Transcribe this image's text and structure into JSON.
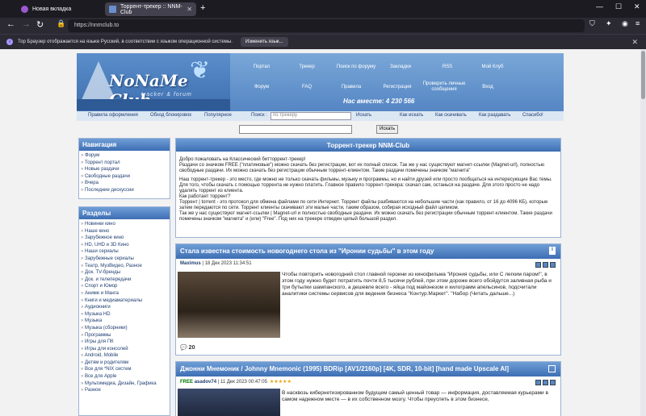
{
  "browser": {
    "tabs": [
      {
        "label": "Новая вкладка"
      },
      {
        "label": "Торрент-трекер :: NNM-Club"
      }
    ],
    "url": "https://nnmclub.to",
    "notification": {
      "text": "Тор Браузер отображается на языке Русский, в соответствии с языком операционной системы.",
      "button": "Изменить язык..."
    }
  },
  "header": {
    "logo_title": "NoNaMe Club",
    "logo_sub": "tracker & forum",
    "online": "Нас вместе: 4 230 566",
    "menu": [
      "Портал",
      "Трекер",
      "Поиск по форуму",
      "Закладки",
      "RSS",
      "Мой Клуб",
      "Форум",
      "FAQ",
      "Правила",
      "Регистрация",
      "Проверить личные сообщения",
      "Вход"
    ],
    "subnav": [
      "Правила оформления",
      "Обход блокировок",
      "Популярное",
      "Поиск :",
      "Искать",
      "Как искать",
      "Как скачивать",
      "Как раздавать",
      "Спасибо!"
    ],
    "search_placeholder": "по трекеру",
    "search_button": "Искать"
  },
  "nav": {
    "title": "Навигация",
    "items": [
      "Форум",
      "Торрент портал",
      "Новые раздачи",
      "Свободные раздачи",
      "Вчера",
      "Последние дискуссии"
    ]
  },
  "sections": {
    "title": "Разделы",
    "items": [
      "Новинки кино",
      "Наше кино",
      "Зарубежное кино",
      "HD, UHD и 3D Кино",
      "Наши сериалы",
      "Зарубежные сериалы",
      "Театр, МузВидео, Разное",
      "Док. TV-бренды",
      "Док. и телепередачи",
      "Спорт и Юмор",
      "Аниме и Манга",
      "Книги и медиаматериалы",
      "Аудиокниги",
      "Музыка HD",
      "Музыка",
      "Музыка (сборники)",
      "Программы",
      "Игры для ПК",
      "Игры для консолей",
      "Android, Mobile",
      "Детям и родителям",
      "Все для *NIX систем",
      "Все для Apple",
      "Мультимедиа, Дизайн, Графика",
      "Разное"
    ]
  },
  "welcome": {
    "title": "Торрент-трекер NNM-Club",
    "p1": "Добро пожаловать на Классический битторрент-трекер!",
    "p2": "Раздачи со значком FREE (\"платиновые\") можно скачать без регистрации, вот их полный список. Так же у нас существуют магнет-ссылки (Magnet-url), полностью свободные раздачи. Их можно скачать без регистрации обычным торрент-клиентом. Такие раздачи помечены значком \"магнита\"",
    "p3": "Наш торрент-трекер - это место, где можно не только скачать фильмы, музыку и программы, но и найти друзей или просто пообщаться на интересующие Вас темы. Для того, чтобы скачать с помощью торрента не нужно платить. Главное правило торрент-трекера: скачал сам, останься на раздаче. Для этого просто не надо удалять торрент из клиента.",
    "p4": "Как работает торрент?",
    "p5": "Торрент | torrent - это протокол для обмена файлами по сети Интернет. Торрент файлы разбиваются на небольшие части (как правило, от 16 до 4096 КБ), которые затем передаются по сети. Торрент клиенты скачивают эти малые части, таким образом, собирая исходный файл целиком.",
    "p6": "Так же у нас существуют магнет-ссылки | Magnet-url и полностью свободные раздачи. Их можно скачать без регистрации обычным торрент-клиентом. Такие раздачи помечены значком \"магнита\" и (или) \"Free\". Под них на трекере отведен целый большой раздел."
  },
  "posts": [
    {
      "title": "Стала известна стоимость новогоднего стола из \"Иронии судьбы\" в этом году",
      "author": "Maximus",
      "date": "18 Дек 2023 11:34:51",
      "text": "Чтобы повторить новогодний стол главной героини из кинофильма \"Ирония судьбы, или С легким паром!\", в этом году нужно будет потратить почти 8,5 тысячи рублей, при этом дороже всего обойдутся заливная рыба и три бутылки шампанского, а дешевле всего - яйца под майонезом и килограмм апельсинов, подсчитали аналитики системы сервисов для ведения бизнеса \"Контур.Маркет\". \"Набор (Читать дальше...)",
      "comments": "20"
    },
    {
      "title": "Джонни Мнемоник / Johnny Mnemonic (1995) BDRip [AV1/2160p] [4K, SDR, 10-bit] [hand made Upscale AI]",
      "free": "FREE",
      "author": "asadov74",
      "date": "11 Дек 2023 00:47:05",
      "stars": "★★★★★",
      "text": "В насквозь кибернетизированном будущем самый ценный товар — информация, доставляемая курьерами в самом надежном месте — в их собственном мозгу. Чтобы преуспеть в этом бизнесе,"
    }
  ],
  "colors": {
    "accent": "#3d6eb3",
    "browser_bg": "#1c1b22"
  }
}
